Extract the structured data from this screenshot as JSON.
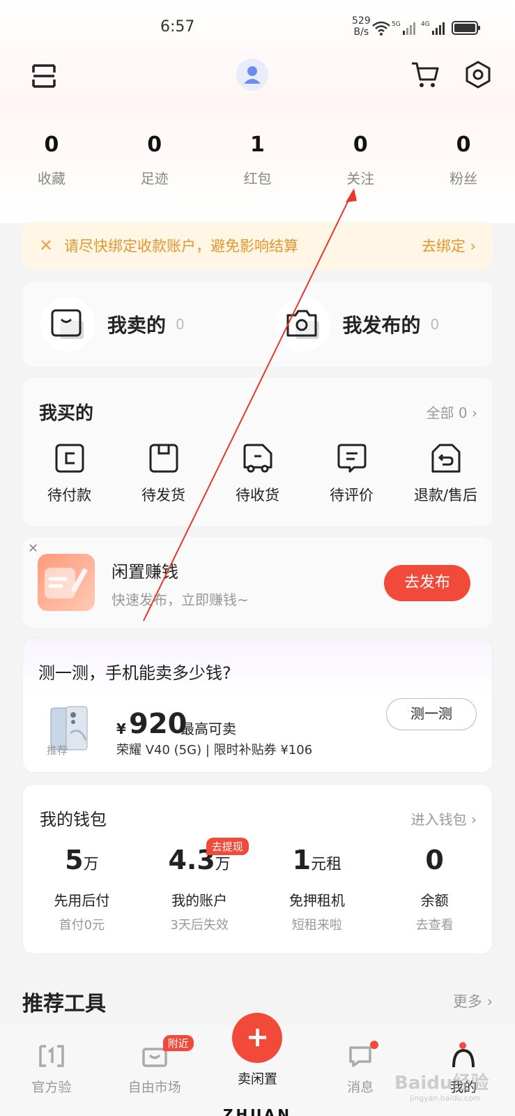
{
  "status_bar": {
    "time": "6:57",
    "net_speed_value": "529",
    "net_speed_unit": "B/s",
    "net1": "5G",
    "net2": "4G"
  },
  "header": {
    "menu_icon": "scan-menu-icon",
    "avatar_icon": "avatar-icon",
    "cart_icon": "cart-icon",
    "settings_icon": "settings-hex-icon"
  },
  "stats": [
    {
      "num": "0",
      "label": "收藏"
    },
    {
      "num": "0",
      "label": "足迹"
    },
    {
      "num": "1",
      "label": "红包"
    },
    {
      "num": "0",
      "label": "关注"
    },
    {
      "num": "0",
      "label": "粉丝"
    }
  ],
  "notice": {
    "message": "请尽快绑定收款账户，避免影响结算",
    "action": "去绑定 ›"
  },
  "sell": {
    "sold_label": "我卖的",
    "sold_count": "0",
    "published_label": "我发布的",
    "published_count": "0"
  },
  "buy": {
    "title": "我买的",
    "more": "全部 0 ›",
    "orders": [
      "待付款",
      "待发货",
      "待收货",
      "待评价",
      "退款/售后"
    ]
  },
  "promo": {
    "title": "闲置赚钱",
    "subtitle": "快速发布，立即赚钱~",
    "button": "去发布"
  },
  "estimate": {
    "title": "测一测，手机能卖多少钱?",
    "tag": "推荐",
    "currency": "¥",
    "price": "920",
    "price_label": "最高可卖",
    "desc": "荣耀 V40 (5G) | 限时补贴券 ¥106",
    "button": "测一测"
  },
  "wallet": {
    "title": "我的钱包",
    "more": "进入钱包 ›",
    "items": [
      {
        "big": "5",
        "unit": "万",
        "l1": "先用后付",
        "l2": "首付0元"
      },
      {
        "big": "4.3",
        "unit": "万",
        "l1": "我的账户",
        "l2": "3天后失效",
        "badge": "去提现"
      },
      {
        "big": "1",
        "unit": "元租",
        "l1": "免押租机",
        "l2": "短租来啦"
      },
      {
        "big": "0",
        "unit": "",
        "l1": "余额",
        "l2": "去查看"
      }
    ]
  },
  "tools": {
    "title": "推荐工具",
    "more": "更多 ›"
  },
  "tabbar": {
    "tabs": [
      "官方验",
      "自由市场",
      "卖闲置",
      "消息",
      "我的"
    ],
    "market_badge": "附近",
    "brand": "ZHUAN",
    "fab": "+"
  },
  "watermark": {
    "text": "Baidu经验",
    "sub": "jingyan.baidu.com"
  },
  "colors": {
    "accent": "#f24a3a",
    "notice_text": "#e5962e",
    "notice_bg": "#fff6e6"
  }
}
